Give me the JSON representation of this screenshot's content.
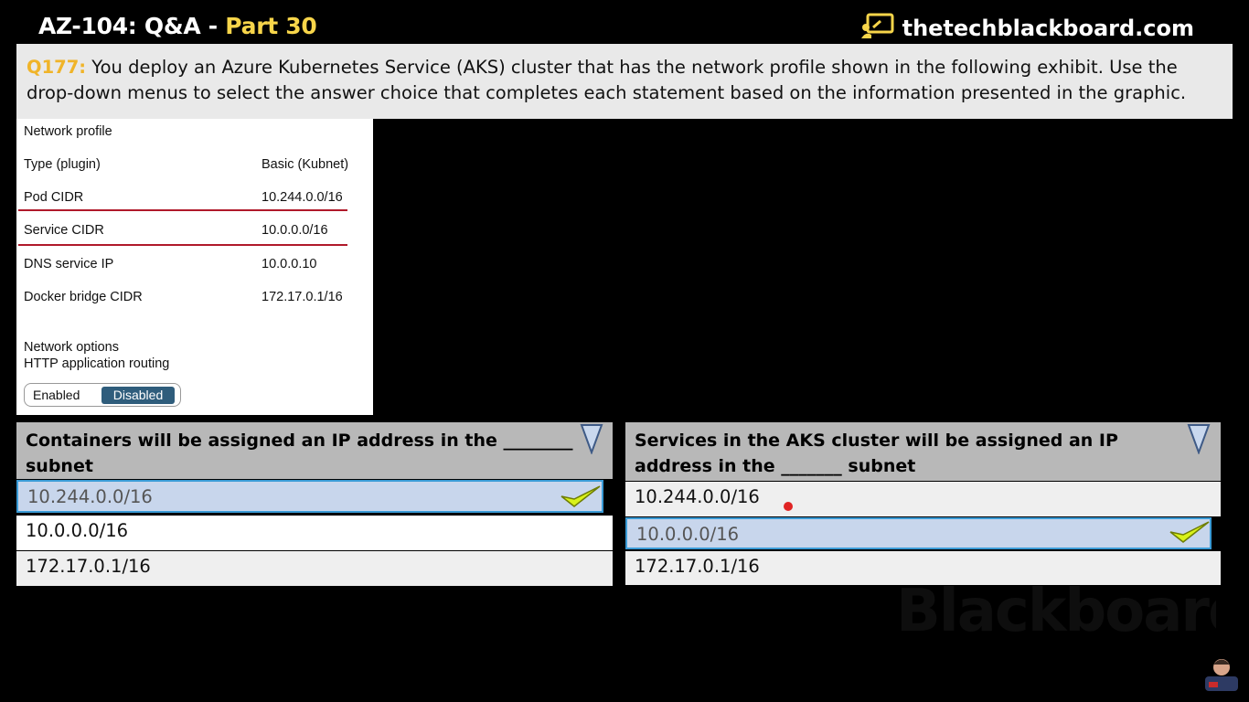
{
  "header": {
    "title_prefix": "AZ-104: Q&A",
    "title_dash": " - ",
    "title_part": "Part 30",
    "brand": "thetechblackboard.com"
  },
  "question": {
    "number": "Q177:",
    "text": " You deploy an Azure Kubernetes Service (AKS) cluster that has the network profile shown in the following exhibit. Use the drop-down menus to select the answer choice that completes each statement based on the information presented in the graphic."
  },
  "exhibit": {
    "heading": "Network profile",
    "rows": [
      {
        "key": "Type (plugin)",
        "value": "Basic (Kubnet)"
      },
      {
        "key": "Pod CIDR",
        "value": "10.244.0.0/16"
      },
      {
        "key": "Service CIDR",
        "value": "10.0.0.0/16"
      },
      {
        "key": "DNS service IP",
        "value": "10.0.0.10"
      },
      {
        "key": "Docker bridge CIDR",
        "value": "172.17.0.1/16"
      }
    ],
    "options_label": "Network options",
    "routing_label": "HTTP application routing",
    "toggle_enabled": "Enabled",
    "toggle_disabled": "Disabled",
    "toggle_selected": "Disabled"
  },
  "dropdown1": {
    "statement": "Containers will be assigned an IP address in the ________ subnet",
    "options": [
      "10.244.0.0/16",
      "10.0.0.0/16",
      "172.17.0.1/16"
    ],
    "selected_index": 0
  },
  "dropdown2": {
    "statement": "Services in the AKS cluster will be assigned an IP address in the _______ subnet",
    "options": [
      "10.244.0.0/16",
      "10.0.0.0/16",
      "172.17.0.1/16"
    ],
    "selected_index": 1
  },
  "watermark": "Blackboard",
  "colors": {
    "accent_yellow": "#f7d54a",
    "qnum_orange": "#f0b429",
    "selected_bg": "#c8d6ec",
    "selected_border": "#3a9bd6",
    "check_green": "#d9f21a",
    "red_underline": "#b0192a",
    "toggle_selected": "#2f5d7c"
  }
}
